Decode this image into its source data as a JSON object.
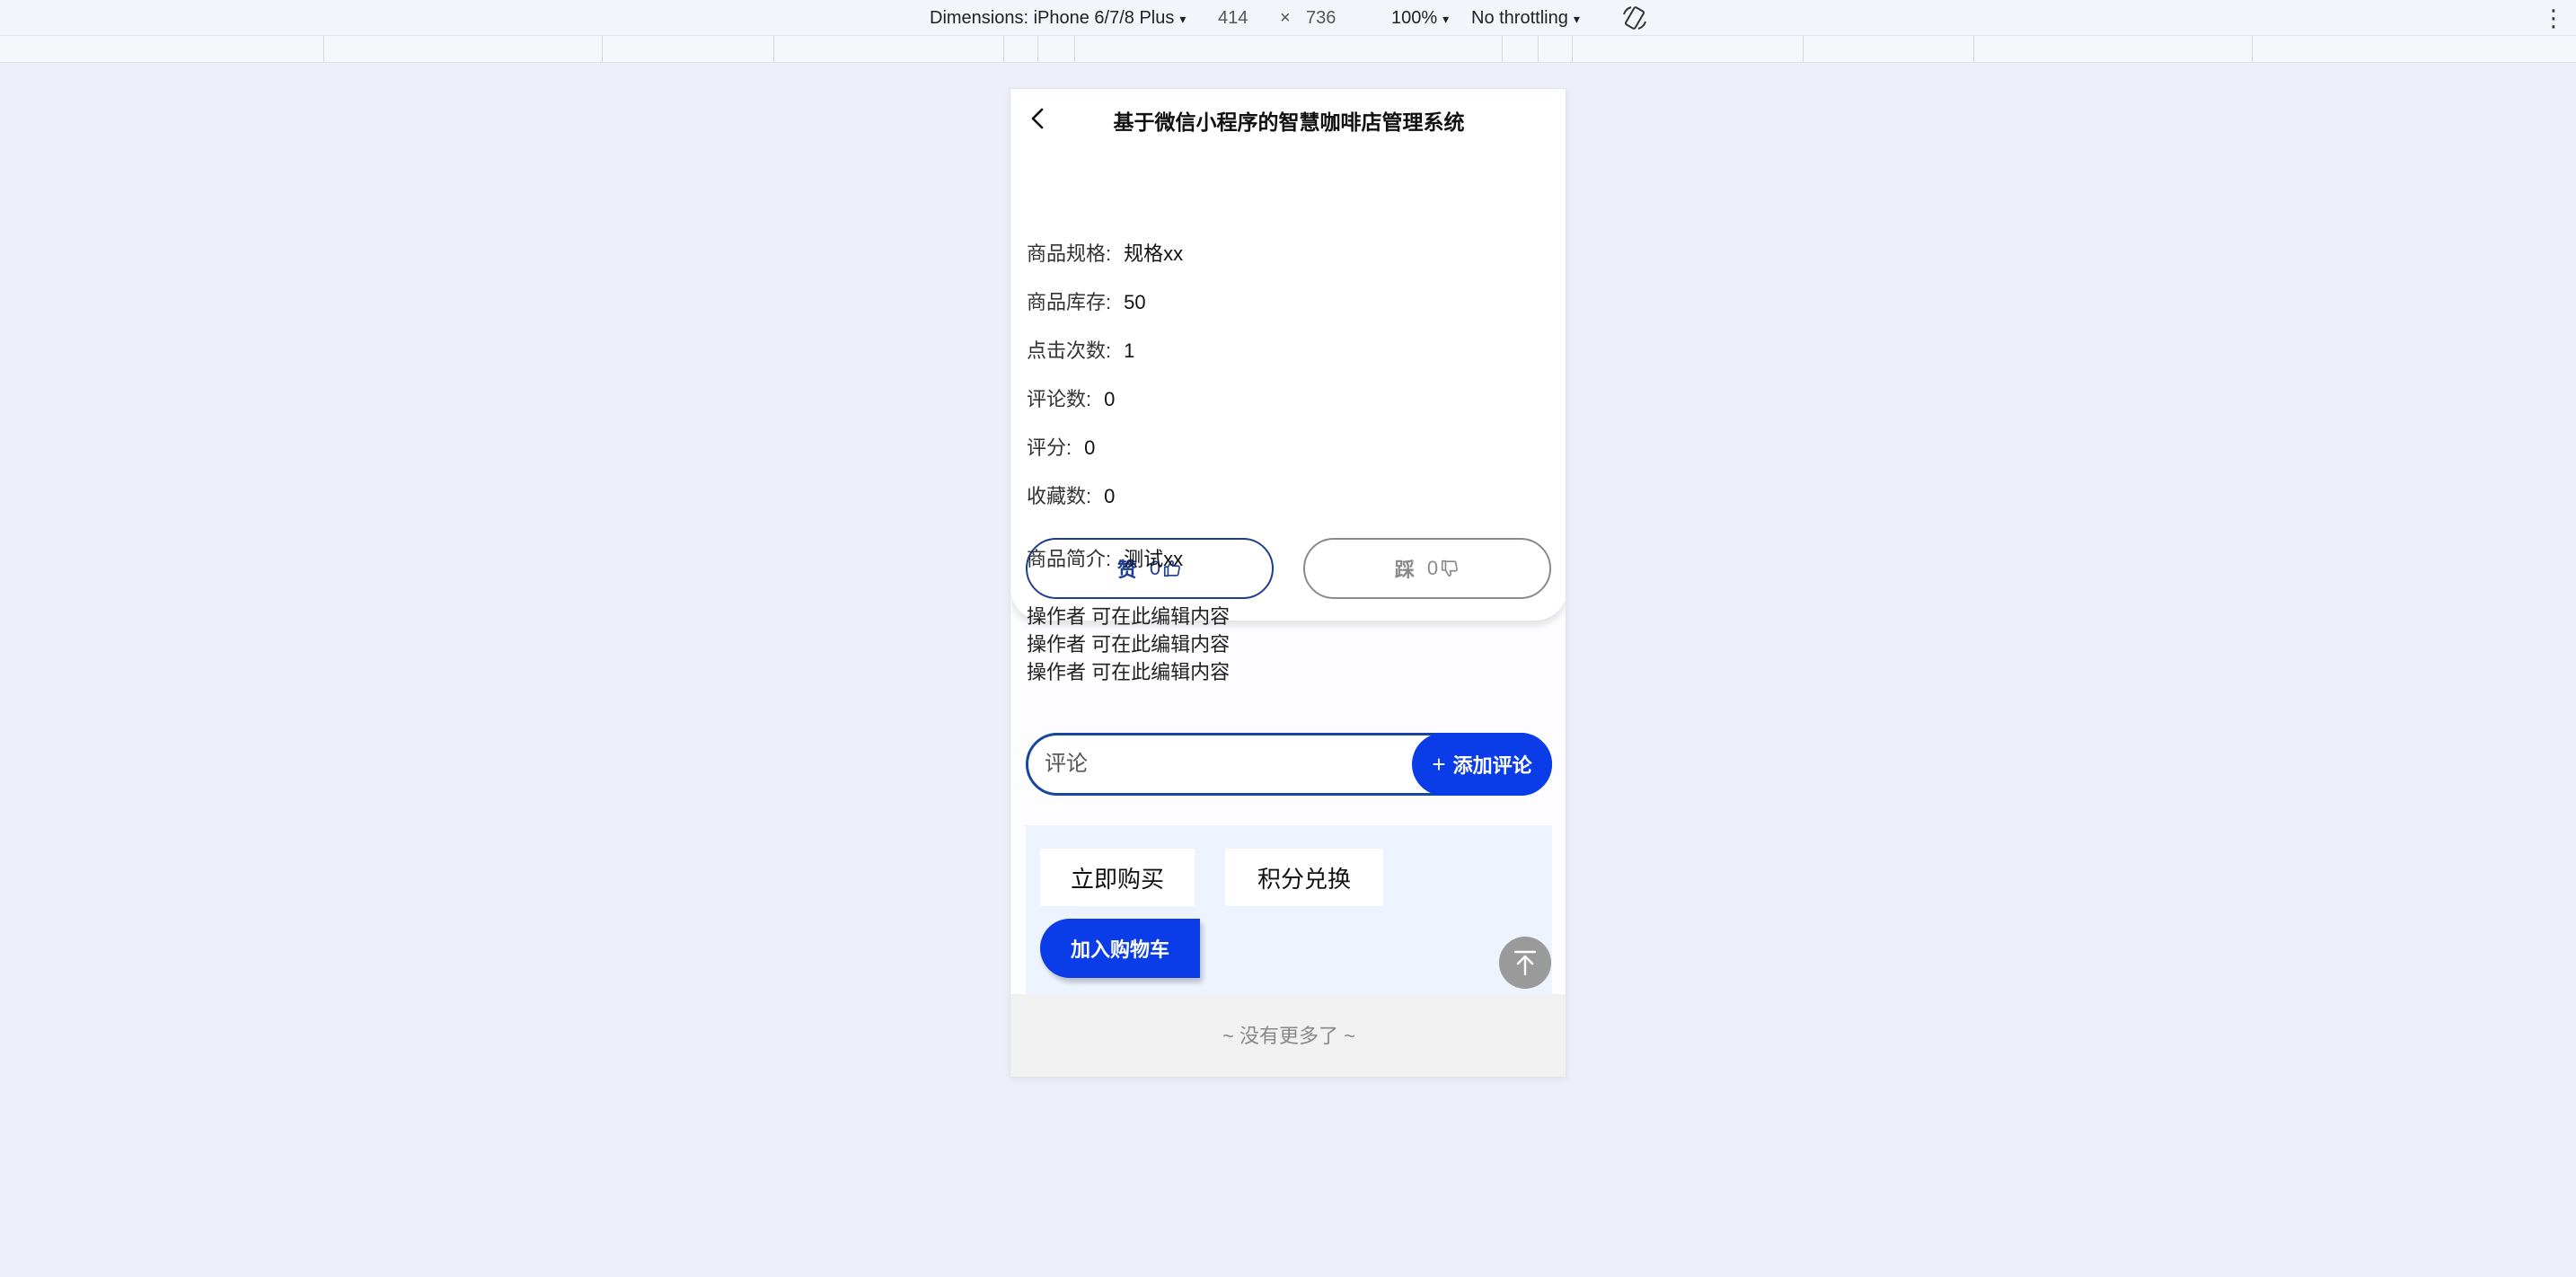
{
  "devtools": {
    "dimensions_label": "Dimensions: iPhone 6/7/8 Plus",
    "width": "414",
    "times": "×",
    "height": "736",
    "zoom": "100%",
    "throttling": "No throttling",
    "caret": "▾",
    "more": "⋮"
  },
  "nav": {
    "title": "基于微信小程序的智慧咖啡店管理系统"
  },
  "details": [
    {
      "label": "商品规格:",
      "value": "规格xx"
    },
    {
      "label": "商品库存:",
      "value": "50"
    },
    {
      "label": "点击次数:",
      "value": "1"
    },
    {
      "label": "评论数:",
      "value": "0"
    },
    {
      "label": "评分:",
      "value": "0"
    },
    {
      "label": "收藏数:",
      "value": "0"
    }
  ],
  "like": {
    "label": "赞",
    "count": "0"
  },
  "dislike": {
    "label": "踩",
    "count": "0"
  },
  "intro": {
    "label": "商品简介:",
    "value": "测试xx"
  },
  "editable_lines": [
    "操作者 可在此编辑内容",
    "操作者 可在此编辑内容",
    "操作者 可在此编辑内容"
  ],
  "comment": {
    "placeholder": "评论",
    "plus": "+",
    "add_label": "添加评论"
  },
  "purchase": {
    "buy_now": "立即购买",
    "points_exchange": "积分兑换",
    "add_to_cart": "加入购物车"
  },
  "footer": {
    "text": "~ 没有更多了 ~"
  },
  "colors": {
    "accent": "#0a3de8",
    "like_border": "#1e3f8f",
    "panel_bg": "#eef4ff"
  }
}
